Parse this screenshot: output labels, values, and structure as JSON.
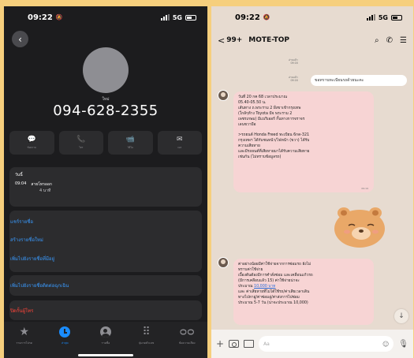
{
  "left_phone": {
    "status": {
      "time": "09:22",
      "network": "5G"
    },
    "contact_label": "ใหม่",
    "phone_number": "094-628-2355",
    "actions": [
      {
        "icon": "message-icon",
        "glyph": "💬",
        "label": "ข้อความ"
      },
      {
        "icon": "phone-icon",
        "glyph": "📞",
        "label": "โทร"
      },
      {
        "icon": "video-icon",
        "glyph": "📹",
        "label": "วิดีโอ"
      },
      {
        "icon": "mail-icon",
        "glyph": "✉",
        "label": "เมล"
      }
    ],
    "recent": {
      "date": "วันนี้",
      "time": "09:04",
      "call_type": "สายโทรออก",
      "duration": "4 นาที"
    },
    "links": {
      "share": "แชร์รายชื่อ",
      "create_contact": "สร้างรายชื่อใหม่",
      "add_existing": "เพิ่มไปยังรายชื่อที่มีอยู่",
      "add_emergency": "เพิ่มไปยังรายชื่อติดต่อฉุกเฉิน",
      "block": "ปิดกั้นผู้โทร"
    },
    "tabs": [
      {
        "icon": "star-icon",
        "glyph": "★",
        "label": "รายการโปรด",
        "active": false
      },
      {
        "icon": "clock-icon",
        "glyph": "",
        "label": "ล่าสุด",
        "active": true
      },
      {
        "icon": "contacts-icon",
        "glyph": "",
        "label": "รายชื่อ",
        "active": false
      },
      {
        "icon": "keypad-icon",
        "glyph": "⠿",
        "label": "ปุ่มกดตัวเลข",
        "active": false
      },
      {
        "icon": "voicemail-icon",
        "glyph": "ᴑᴑ",
        "label": "ข้อความเสียง",
        "active": false
      }
    ]
  },
  "right_phone": {
    "status": {
      "time": "09:22",
      "network": "5G"
    },
    "header": {
      "back_count": "99+",
      "title": "MOTE-TOP"
    },
    "meta_1": {
      "status": "อ่านแล้ว",
      "time": "09:16"
    },
    "meta_2": {
      "status": "อ่านแล้ว",
      "time": "09:16"
    },
    "outgoing_text": "ขอทราบทะเบียนรถด้วยนะคะ",
    "message_1": {
      "lines": [
        "วันที่ 20 กค 68 เวลาประมาณ",
        "05.40-05.50 น.",
        "เส้นทาง ถ.พระราม 2 ฝั่งขาเข้ากรุงเทพ",
        "(ใกล้ๆห้าง Toyota มีจ พระราม 2",
        "เพชรเกษม) มีแบริเออร์ กั้นทางการจราจร",
        "เลนขวามือ",
        "",
        ">รถยนต์ Honda Freed ทะเบียน 6กด-321",
        "กรุงเทพฯ ได้กับชนหน้า/ไฟหน้า (ขวา) ได้รับ",
        "ความเสียหาย",
        "และมีรถยนต์ที่เสียหายมาได้รับความเสียหาย",
        "เช่นกัน (ไม่ทราบข้อมูลรถ)"
      ],
      "time": "09:19"
    },
    "message_2": {
      "lines": [
        "ค่าอย่างน้อยมีค่าใช้จ่ายจากการซ่อมรถ ยังไม่",
        "ทราบค่าใช้จ่าย",
        "เบื้องต้นต้องมีการคำสั่งซ่อม และเคลื่อนแก้วรถ",
        "(มีการเคลือบแล้ว 15) ค่าใช้จ่ายน่าจะ",
        "ประมาณ",
        "และ ค่าเสียหายที่ไม่ได้ใช้รถ/ค่าเสียเวลาเดิน",
        "ทางไปหาอู่/ค่าซ่อมอู่/ค่าส่งการไปซ่อม",
        "ประมาณ 5-7 วัน (น่าจะประมาณ 10,000)"
      ],
      "amount": "10,000 บาท"
    },
    "input_placeholder": "Aa"
  }
}
